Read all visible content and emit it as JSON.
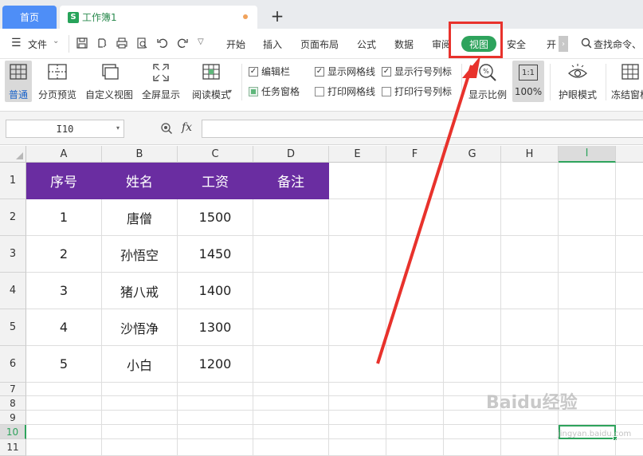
{
  "tabs": {
    "home": "首页",
    "doc_icon": "S",
    "doc_title": "工作簿1",
    "new_tab": "+"
  },
  "menu": {
    "file": "文件",
    "items": [
      "开始",
      "插入",
      "页面布局",
      "公式",
      "数据",
      "审阅",
      "视图",
      "安全",
      "开"
    ],
    "search": "查找命令、"
  },
  "ribbon": {
    "normal": "普通",
    "page_break_preview": "分页预览",
    "custom_view": "自定义视图",
    "full_screen": "全屏显示",
    "reading_mode": "阅读模式",
    "checkboxes": [
      {
        "label": "编辑栏",
        "checked": true
      },
      {
        "label": "显示网格线",
        "checked": true
      },
      {
        "label": "显示行号列标",
        "checked": true
      },
      {
        "label": "任务窗格",
        "checked": false
      },
      {
        "label": "打印网格线",
        "checked": false
      },
      {
        "label": "打印行号列标",
        "checked": false
      }
    ],
    "zoom_ratio": "显示比例",
    "zoom_100": "100%",
    "zoom_100_icon": "1:1",
    "eye_protect": "护眼模式",
    "freeze": "冻结窗格"
  },
  "formula_bar": {
    "cell_ref": "I10",
    "fx": "fx",
    "value": ""
  },
  "sheet": {
    "columns": [
      "A",
      "B",
      "C",
      "D",
      "E",
      "F",
      "G",
      "H",
      "I"
    ],
    "rows": [
      "1",
      "2",
      "3",
      "4",
      "5",
      "6",
      "7",
      "8",
      "9",
      "10",
      "11"
    ],
    "header": [
      "序号",
      "姓名",
      "工资",
      "备注"
    ],
    "data": [
      [
        "1",
        "唐僧",
        "1500",
        ""
      ],
      [
        "2",
        "孙悟空",
        "1450",
        ""
      ],
      [
        "3",
        "猪八戒",
        "1400",
        ""
      ],
      [
        "4",
        "沙悟净",
        "1300",
        ""
      ],
      [
        "5",
        "小白",
        "1200",
        ""
      ]
    ],
    "selected_cell": "I10"
  },
  "colors": {
    "header_fill": "#6a2da1",
    "view_tab": "#2ea35c",
    "annotation": "#e8322c",
    "home_tab": "#4e8ef7"
  },
  "watermark": {
    "main": "Baidu经验",
    "sub": "jingyan.baidu.com"
  }
}
